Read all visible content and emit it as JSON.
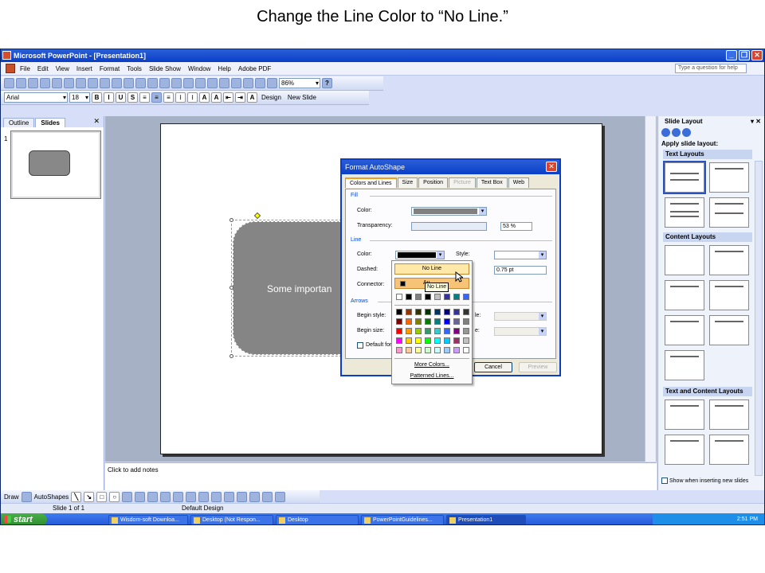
{
  "caption": "Change the Line Color to “No Line.”",
  "window": {
    "title": "Microsoft PowerPoint - [Presentation1]"
  },
  "menu": [
    "File",
    "Edit",
    "View",
    "Insert",
    "Format",
    "Tools",
    "Slide Show",
    "Window",
    "Help",
    "Adobe PDF"
  ],
  "help_placeholder": "Type a question for help",
  "toolbar": {
    "zoom": "86%",
    "font": "Arial",
    "font_size": "18",
    "design_label": "Design",
    "new_slide_label": "New Slide"
  },
  "left_pane": {
    "tab_outline": "Outline",
    "tab_slides": "Slides",
    "slide_number": "1"
  },
  "slide": {
    "shape_text": "Some importan"
  },
  "notes_placeholder": "Click to add notes",
  "task_pane": {
    "title": "Slide Layout",
    "apply_label": "Apply slide layout:",
    "sec_text": "Text Layouts",
    "sec_content": "Content Layouts",
    "sec_text_content": "Text and Content Layouts",
    "show_checkbox": "Show when inserting new slides"
  },
  "draw_toolbar": {
    "draw": "Draw",
    "autoshapes": "AutoShapes"
  },
  "status": {
    "slide": "Slide 1 of 1",
    "design": "Default Design"
  },
  "taskbar": {
    "start": "start",
    "tasks": [
      "Wisdom-soft Downloa...",
      "Desktop (Not Respon...",
      "Desktop",
      "PowerPointGuidelines...",
      "Presentation1"
    ],
    "clock": "2:51 PM"
  },
  "dialog": {
    "title": "Format AutoShape",
    "tabs": [
      "Colors and Lines",
      "Size",
      "Position",
      "Picture",
      "Text Box",
      "Web"
    ],
    "fill_section": "Fill",
    "color_label": "Color:",
    "transparency_label": "Transparency:",
    "transparency_value": "53 %",
    "line_section": "Line",
    "line_color_label": "Color:",
    "style_label": "Style:",
    "dashed_label": "Dashed:",
    "weight_value": "0.75 pt",
    "connector_label": "Connector:",
    "arrows_section": "Arrows",
    "begin_style_label": "Begin style:",
    "begin_size_label": "Begin size:",
    "end_style_suffix": "le:",
    "end_size_suffix": "e:",
    "default_label": "Default for",
    "cancel_label": "Cancel",
    "preview_label": "Preview"
  },
  "popup": {
    "no_line": "No Line",
    "automatic": "Au",
    "tooltip": "No Line",
    "more_colors": "More Colors...",
    "patterned": "Patterned Lines...",
    "recent_colors": [
      "#ffffff",
      "#000000",
      "#808080",
      "#000000",
      "#c0c0c0",
      "#333399",
      "#008080",
      "#3366ff"
    ],
    "palette": [
      "#000000",
      "#993300",
      "#333300",
      "#003300",
      "#003366",
      "#000080",
      "#333399",
      "#333333",
      "#800000",
      "#ff6600",
      "#808000",
      "#008000",
      "#008080",
      "#0000ff",
      "#666699",
      "#808080",
      "#ff0000",
      "#ff9900",
      "#99cc00",
      "#339966",
      "#33cccc",
      "#3366ff",
      "#800080",
      "#969696",
      "#ff00ff",
      "#ffcc00",
      "#ffff00",
      "#00ff00",
      "#00ffff",
      "#00ccff",
      "#993366",
      "#c0c0c0",
      "#ff99cc",
      "#ffcc99",
      "#ffff99",
      "#ccffcc",
      "#ccffff",
      "#99ccff",
      "#cc99ff",
      "#ffffff"
    ]
  }
}
